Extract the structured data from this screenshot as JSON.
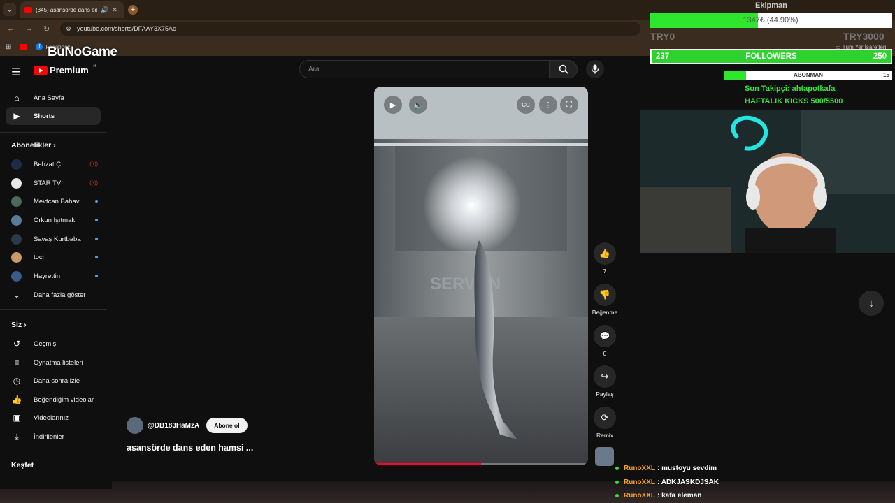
{
  "browser": {
    "tab_title": "(345) asansörde dans eden",
    "url": "youtube.com/shorts/DFAAY3X75Ac",
    "bookmark_facebook": "Facebook",
    "bookmarks_all": "Tüm Yer İşaretleri"
  },
  "watermark": "BuNoGame",
  "youtube": {
    "brand": "Premium",
    "region": "TR",
    "search_placeholder": "Ara",
    "nav": [
      {
        "label": "Ana Sayfa",
        "icon": "home-icon"
      },
      {
        "label": "Shorts",
        "icon": "shorts-icon"
      }
    ],
    "subscriptions_heading": "Abonelikler",
    "subscriptions": [
      {
        "label": "Behzat Ç.",
        "status": "live",
        "color": "#1d2b4a"
      },
      {
        "label": "STAR TV",
        "status": "live",
        "color": "#e8e8e8"
      },
      {
        "label": "Mevtcan Bahav",
        "status": "new",
        "color": "#4a6a5a"
      },
      {
        "label": "Orkun Işıtmak",
        "status": "new",
        "color": "#5a7a9a"
      },
      {
        "label": "Savaş Kurtbaba",
        "status": "new",
        "color": "#2a3a4a"
      },
      {
        "label": "toci",
        "status": "new",
        "color": "#c89a6a"
      },
      {
        "label": "Hayrettin",
        "status": "new",
        "color": "#3a5a8a"
      }
    ],
    "show_more": "Daha fazla göster",
    "you_heading": "Siz",
    "you_items": [
      {
        "label": "Geçmiş",
        "icon": "history-icon"
      },
      {
        "label": "Oynatma listeleri",
        "icon": "playlist-icon"
      },
      {
        "label": "Daha sonra izle",
        "icon": "clock-icon"
      },
      {
        "label": "Beğendiğim videolar",
        "icon": "thumbs-up-icon"
      },
      {
        "label": "Videolarınız",
        "icon": "video-icon"
      },
      {
        "label": "İndirilenler",
        "icon": "download-icon"
      }
    ],
    "explore_heading": "Keşfet",
    "short": {
      "channel": "@DB183HaMzA",
      "subscribe_label": "Abone ol",
      "title": "asansörde dans eden hamsi ...",
      "likes": "7",
      "dislike_label": "Beğenme",
      "comments": "0",
      "share_label": "Paylaş",
      "remix_label": "Remix",
      "progress": 0.5
    }
  },
  "stream": {
    "goal_name": "Ekipman",
    "goal_text": "1347₺ (44.90%)",
    "goal_progress": 0.449,
    "try_min": "TRY0",
    "try_max": "TRY3000",
    "followers_current": "237",
    "followers_label": "FOLLOWERS",
    "followers_goal": "250",
    "subs_label": "ABONMAN",
    "subs_count": "15",
    "subs_progress": 0.13,
    "last_follower": "Son Takipçi: ahtapotkafa",
    "kicks": "HAFTALIK KICKS 500/5500",
    "chat": [
      {
        "user": "RunoXXL",
        "msg": ": mustoyu sevdim"
      },
      {
        "user": "RunoXXL",
        "msg": ": ADKJASKDJSAK"
      },
      {
        "user": "RunoXXL",
        "msg": ": kafa eleman"
      }
    ]
  }
}
